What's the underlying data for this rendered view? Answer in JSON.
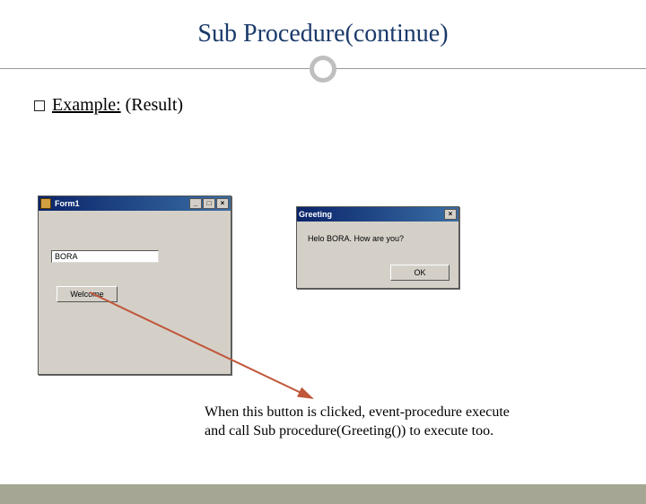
{
  "slide": {
    "title": "Sub Procedure(continue)",
    "example_label": "Example:",
    "example_suffix": " (Result)"
  },
  "form1": {
    "title": "Form1",
    "input_value": "BORA",
    "welcome_button": "Welcome"
  },
  "dialog": {
    "title": "Greeting",
    "message": "Helo BORA. How are you?",
    "ok": "OK"
  },
  "caption": {
    "line1": "When this button is clicked, event-procedure execute",
    "line2": "and call Sub procedure(Greeting()) to execute too."
  },
  "arrow": {
    "color": "#c0563a"
  }
}
